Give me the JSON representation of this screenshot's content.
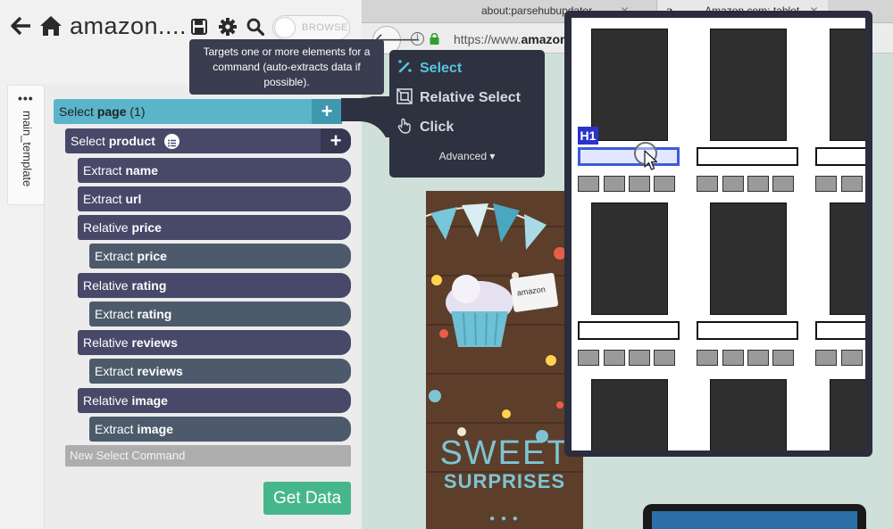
{
  "browser": {
    "tabs": [
      {
        "label": "about:parsehubupdater"
      },
      {
        "label": "Amazon.com: tablet"
      }
    ],
    "tab_favicon": "a",
    "url_prefix": "https://www.",
    "url_domain": "amazon",
    "banner_title": "SWEET",
    "banner_subtitle": "SURPRISES",
    "banner_dots": "● ● ●"
  },
  "panel": {
    "project_title": "amazon....",
    "browse_label": "BROWSE",
    "template_tab": "main_template",
    "tab_dots": "•••",
    "commands": [
      {
        "verb": "Select",
        "target": "page",
        "suffix": "(1)"
      },
      {
        "verb": "Select",
        "target": "product"
      },
      {
        "verb": "Extract",
        "target": "name"
      },
      {
        "verb": "Extract",
        "target": "url"
      },
      {
        "verb": "Relative",
        "target": "price"
      },
      {
        "verb": "Extract",
        "target": "price"
      },
      {
        "verb": "Relative",
        "target": "rating"
      },
      {
        "verb": "Extract",
        "target": "rating"
      },
      {
        "verb": "Relative",
        "target": "reviews"
      },
      {
        "verb": "Extract",
        "target": "reviews"
      },
      {
        "verb": "Relative",
        "target": "image"
      },
      {
        "verb": "Extract",
        "target": "image"
      }
    ],
    "plus_symbol": "+",
    "new_command_placeholder": "New Select Command",
    "get_data_label": "Get Data"
  },
  "tooltip": {
    "text": "Targets one or more elements for a command (auto-extracts data if possible)."
  },
  "menu": {
    "items": [
      {
        "label": "Select",
        "icon": "magic-wand-icon"
      },
      {
        "label": "Relative Select",
        "icon": "relative-select-icon"
      },
      {
        "label": "Click",
        "icon": "hand-pointer-icon"
      }
    ],
    "advanced_label": "Advanced ▾"
  },
  "preview": {
    "badge": "H1"
  },
  "colors": {
    "select_accent": "#59c4e0",
    "page_select": "#5ab5ca",
    "command_dark": "#484869",
    "command_mid": "#4d5a6c",
    "get_data": "#46b68d",
    "highlight": "#3b5bd6"
  }
}
